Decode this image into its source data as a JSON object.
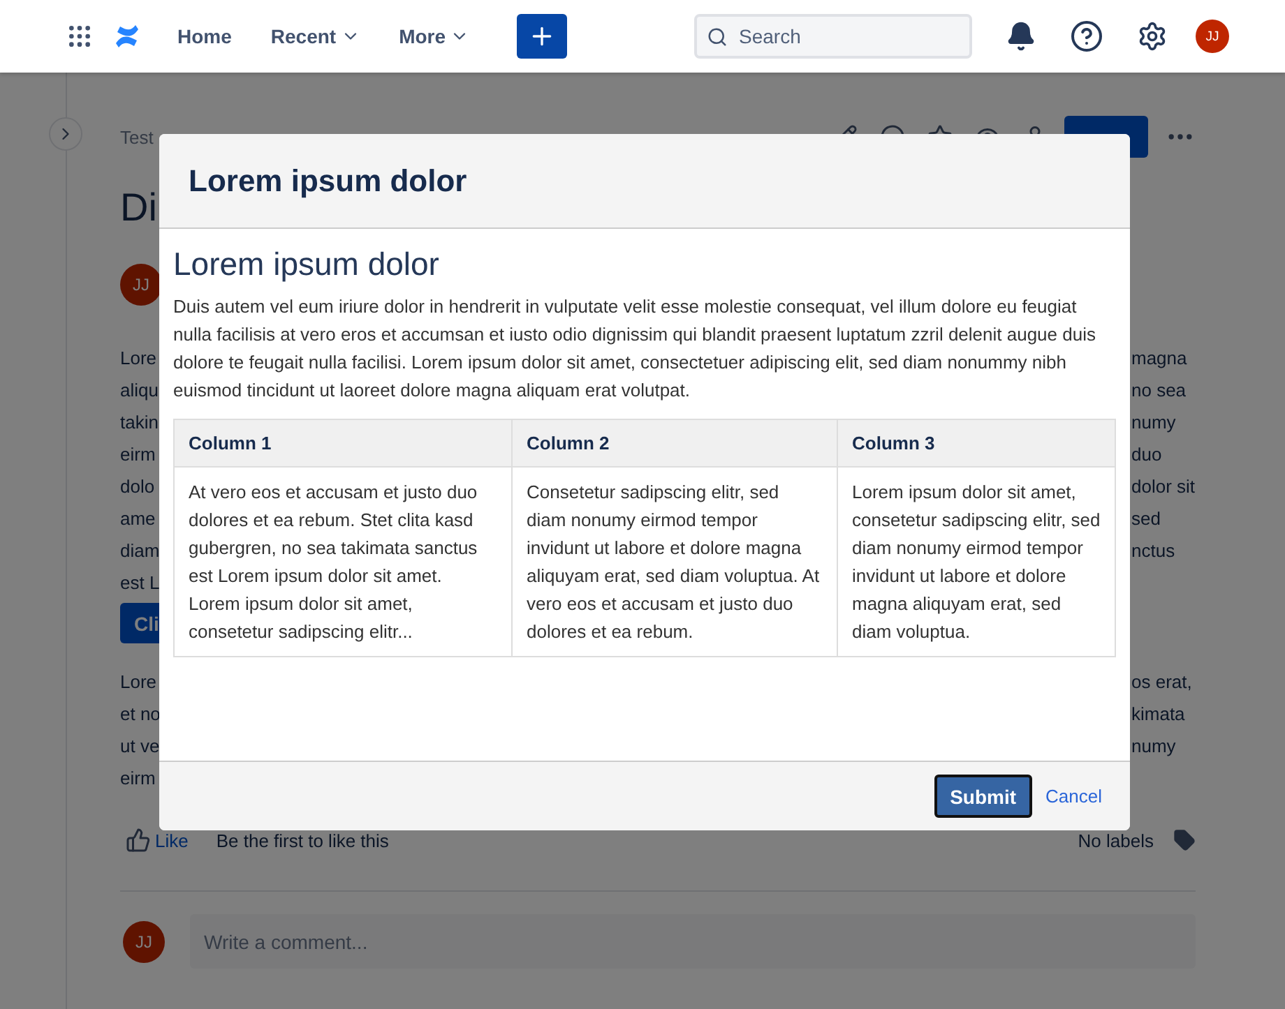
{
  "topbar": {
    "nav": [
      {
        "label": "Home",
        "dropdown": false
      },
      {
        "label": "Recent",
        "dropdown": true
      },
      {
        "label": "More",
        "dropdown": true
      }
    ],
    "search": {
      "placeholder": "Search"
    },
    "avatar": "JJ"
  },
  "page": {
    "breadcrumb": "Test",
    "title": "Di",
    "author_avatar": "JJ",
    "paragraph_1": [
      {
        "left": "Lore",
        "right": "magna"
      },
      {
        "left": "aliqu",
        "right": "no sea"
      },
      {
        "left": "takin",
        "right": "numy"
      },
      {
        "left": "eirm",
        "right": "duo"
      },
      {
        "left": "dolo",
        "right": "dolor sit"
      },
      {
        "left": "ame",
        "right": "sed"
      },
      {
        "left": "diam",
        "right": "nctus"
      },
      {
        "left": "est L"
      }
    ],
    "button": "Cli",
    "paragraph_2": [
      {
        "left": "Lore",
        "right": "os erat,"
      },
      {
        "left": "et no",
        "right": "kimata"
      },
      {
        "left": "ut ve",
        "right": "numy"
      },
      {
        "left": "eirm"
      }
    ],
    "like": "Like",
    "like_note": "Be the first to like this",
    "labels": "No labels",
    "comment": {
      "avatar": "JJ",
      "placeholder": "Write a comment..."
    }
  },
  "dialog": {
    "title": "Lorem ipsum dolor",
    "heading": "Lorem ipsum dolor",
    "text": "Duis autem vel eum iriure dolor in hendrerit in vulputate velit esse molestie consequat, vel illum dolore eu feugiat nulla facilisis at vero eros et accumsan et iusto odio dignissim qui blandit praesent luptatum zzril delenit augue duis dolore te feugait nulla facilisi. Lorem ipsum dolor sit amet, consectetuer adipiscing elit, sed diam nonummy nibh euismod tincidunt ut laoreet dolore magna aliquam erat volutpat.",
    "table": {
      "columns": [
        "Column 1",
        "Column 2",
        "Column 3"
      ],
      "rows": [
        [
          "At vero eos et accusam et justo duo dolores et ea rebum. Stet clita kasd gubergren, no sea takimata sanctus est Lorem ipsum dolor sit amet. Lorem ipsum dolor sit amet, consetetur sadipscing elitr...",
          "Consetetur sadipscing elitr, sed diam nonumy eirmod tempor invidunt ut labore et dolore magna aliquyam erat, sed diam voluptua. At vero eos et accusam et justo duo dolores et ea rebum.",
          "Lorem ipsum dolor sit amet, consetetur sadipscing elitr, sed diam nonumy eirmod tempor invidunt ut labore et dolore magna aliquyam erat, sed diam voluptua."
        ]
      ]
    },
    "submit": "Submit",
    "cancel": "Cancel"
  }
}
